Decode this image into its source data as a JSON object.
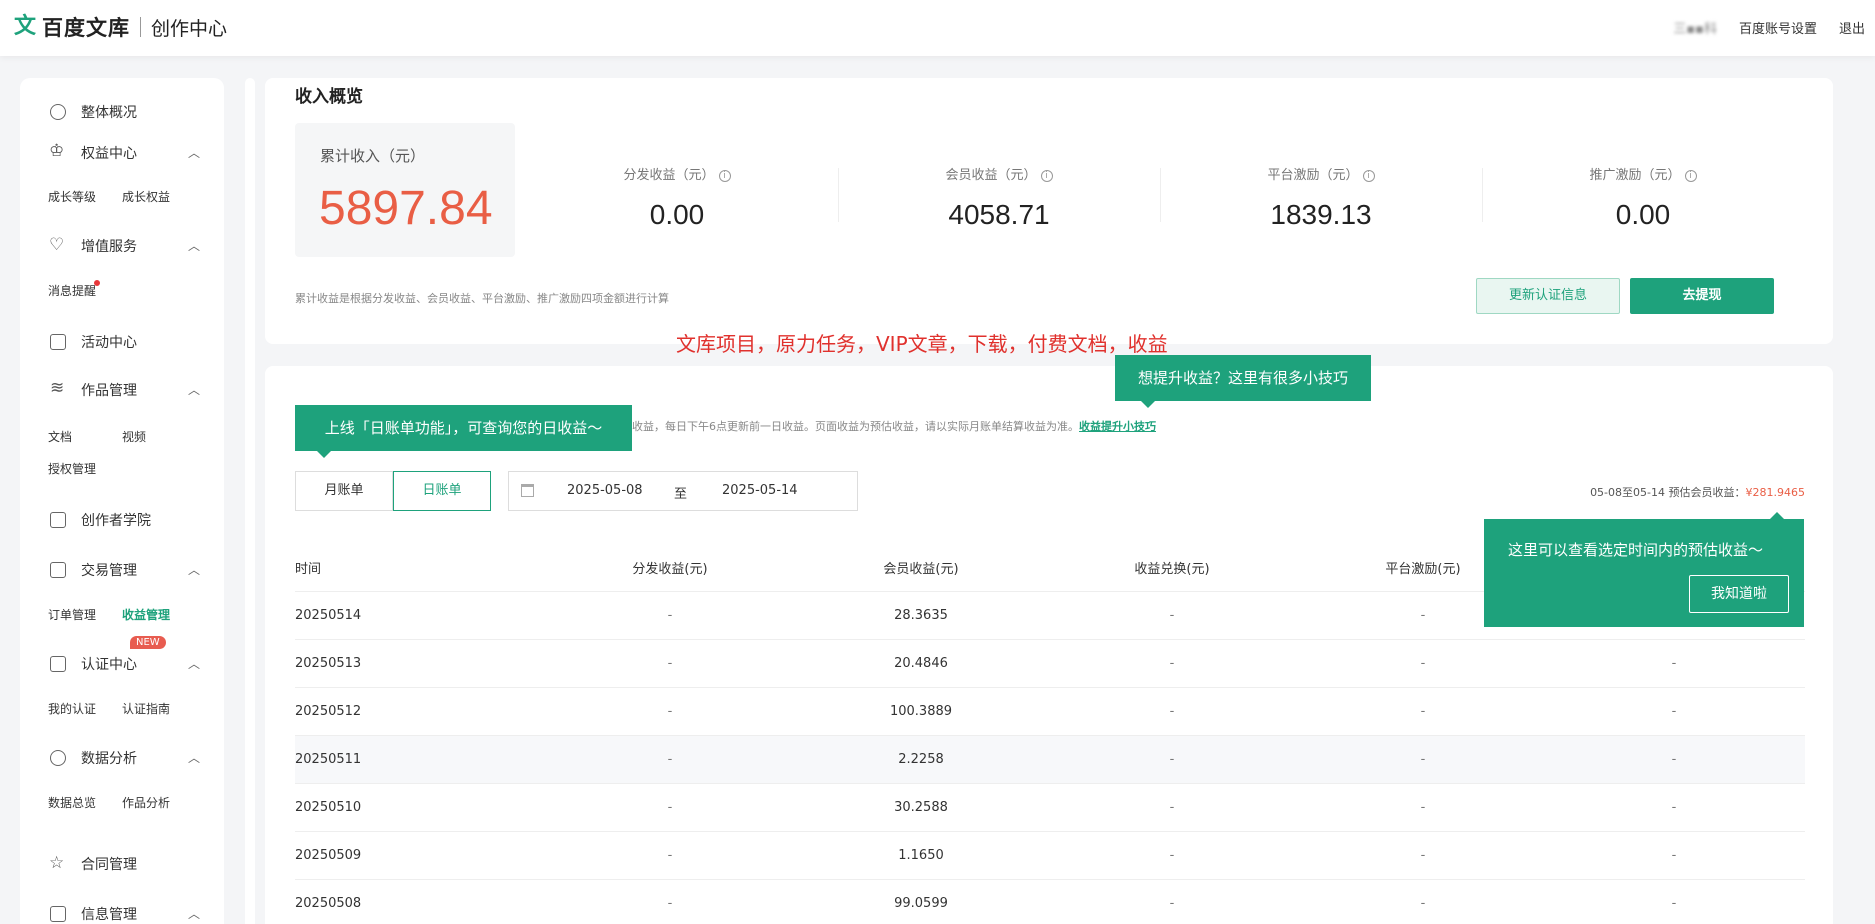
{
  "header": {
    "logo_mark": "文",
    "logo_text": "百度文库",
    "logo_sub": "创作中心",
    "user_name": "三▪▪科",
    "account_settings": "百度账号设置",
    "logout": "退出"
  },
  "sidebar": {
    "overview": "整体概况",
    "rights_center": "权益中心",
    "growth_level": "成长等级",
    "growth_rights": "成长权益",
    "value_services": "增值服务",
    "message_alert": "消息提醒",
    "activity_center": "活动中心",
    "works_mgmt": "作品管理",
    "docs": "文档",
    "videos": "视频",
    "auth_mgmt": "授权管理",
    "creator_academy": "创作者学院",
    "trade_mgmt": "交易管理",
    "order_mgmt": "订单管理",
    "income_mgmt": "收益管理",
    "new_badge": "NEW",
    "cert_center": "认证中心",
    "my_cert": "我的认证",
    "cert_guide": "认证指南",
    "data_analysis": "数据分析",
    "data_overview": "数据总览",
    "works_analysis": "作品分析",
    "contract_mgmt": "合同管理",
    "info_mgmt": "信息管理"
  },
  "income": {
    "title": "收入概览",
    "total_label": "累计收入（元）",
    "total_value": "5897.84",
    "stats": [
      {
        "label": "分发收益（元）",
        "value": "0.00"
      },
      {
        "label": "会员收益（元）",
        "value": "4058.71"
      },
      {
        "label": "平台激励（元）",
        "value": "1839.13"
      },
      {
        "label": "推广激励（元）",
        "value": "0.00"
      }
    ],
    "note": "累计收益是根据分发收益、会员收益、平台激励、推广激励四项金额进行计算",
    "update_cert_button": "更新认证信息",
    "withdraw_button": "去提现"
  },
  "caption": "文库项目，原力任务，VIP文章，下载，付费文档，收益",
  "tooltips": {
    "tip_tricks": "想提升收益？这里有很多小技巧",
    "tip_daily": "上线「日账单功能」，可查询您的日收益～",
    "tip_estimate": "这里可以查看选定时间内的预估收益～",
    "tip_estimate_ok": "我知道啦"
  },
  "bill": {
    "note": "收益，每日下午6点更新前一日收益。页面收益为预估收益，请以实际月账单结算收益为准。",
    "note_link": "收益提升小技巧",
    "tab_monthly": "月账单",
    "tab_daily": "日账单",
    "date_start": "2025-05-08",
    "date_to": "至",
    "date_end": "2025-05-14",
    "estimate_label": "05-08至05-14 预估会员收益：",
    "estimate_value": "¥281.9465",
    "columns": [
      "时间",
      "分发收益(元)",
      "会员收益(元)",
      "收益兑换(元)",
      "平台激励(元)"
    ],
    "rows": [
      [
        "20250514",
        "-",
        "28.3635",
        "-",
        "-",
        "-"
      ],
      [
        "20250513",
        "-",
        "20.4846",
        "-",
        "-",
        "-"
      ],
      [
        "20250512",
        "-",
        "100.3889",
        "-",
        "-",
        "-"
      ],
      [
        "20250511",
        "-",
        "2.2258",
        "-",
        "-",
        "-"
      ],
      [
        "20250510",
        "-",
        "30.2588",
        "-",
        "-",
        "-"
      ],
      [
        "20250509",
        "-",
        "1.1650",
        "-",
        "-",
        "-"
      ],
      [
        "20250508",
        "-",
        "99.0599",
        "-",
        "-",
        "-"
      ]
    ]
  },
  "colors": {
    "brand_green": "#1ea27c",
    "accent_red": "#e95e45",
    "caption_red": "#e0312d"
  }
}
